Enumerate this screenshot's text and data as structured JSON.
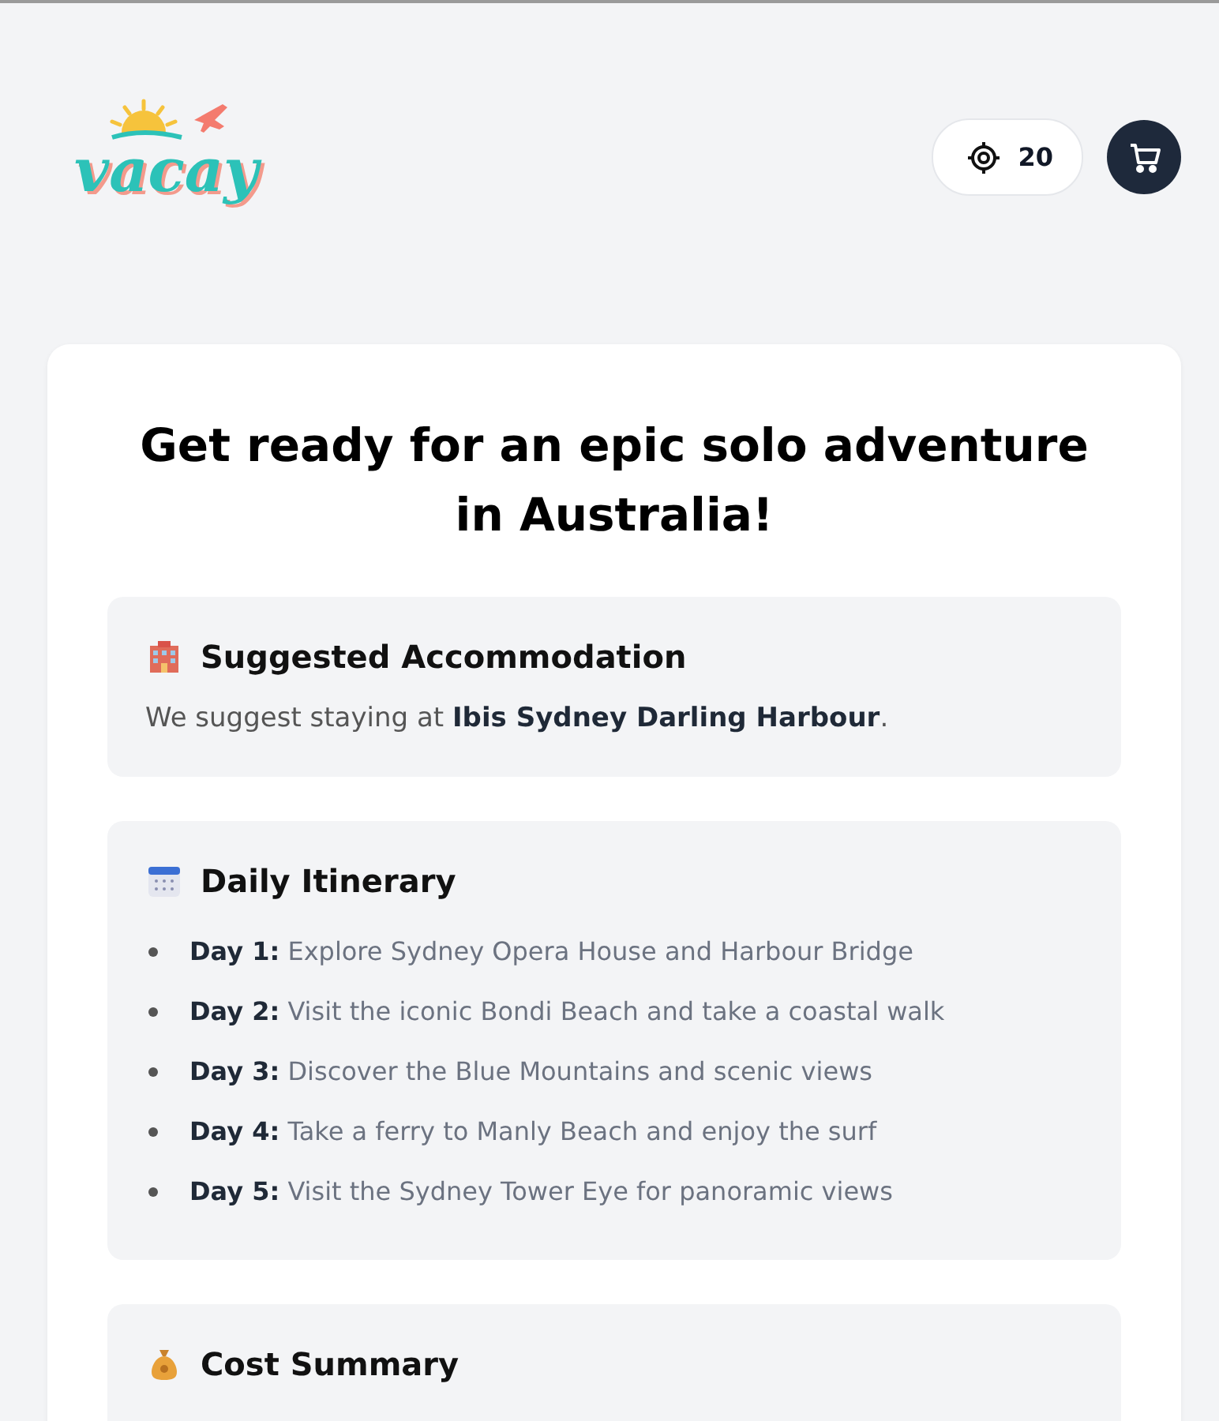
{
  "header": {
    "logo": {
      "text": "vacay"
    },
    "points": {
      "value": "20"
    }
  },
  "card": {
    "title": "Get ready for an epic solo adventure in Australia!",
    "sections": [
      {
        "kind": "paragraph",
        "heading": "Suggested Accommodation",
        "text": "We suggest staying at **Ibis Sydney Darling Harbour**."
      },
      {
        "kind": "list",
        "heading": "Daily Itinerary",
        "items": [
          "**Day 1:** Explore Sydney Opera House and Harbour Bridge",
          "**Day 2:** Visit the iconic Bondi Beach and take a coastal walk",
          "**Day 3:** Discover the Blue Mountains and scenic views",
          "**Day 4:** Take a ferry to Manly Beach and enjoy the surf",
          "**Day 5:** Visit the Sydney Tower Eye for panoramic views"
        ]
      },
      {
        "kind": "paragraph",
        "heading": "Cost Summary"
      }
    ]
  }
}
